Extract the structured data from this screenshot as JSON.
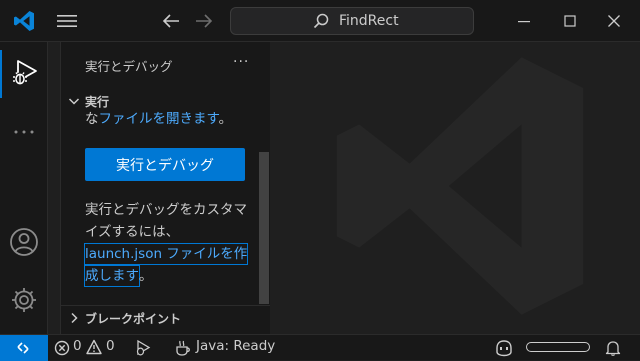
{
  "colors": {
    "accent": "#0078d4",
    "link": "#4daafc",
    "background": "#1f1f1f",
    "chrome": "#181818",
    "text": "#cccccc"
  },
  "titlebar": {
    "search_text": "FindRect",
    "icons": [
      "vscode-logo-icon",
      "hamburger-menu-icon",
      "arrow-left-icon",
      "arrow-right-icon",
      "search-icon",
      "minimize-icon",
      "maximize-icon",
      "close-icon"
    ]
  },
  "activity_bar": {
    "icons": [
      "run-debug-icon",
      "more-icon",
      "account-icon",
      "settings-gear-icon"
    ]
  },
  "sidebar": {
    "title": "実行とデバッグ",
    "more_label": "···",
    "run_section": {
      "label": "実行",
      "partial_prefix": "な",
      "partial_link": "ファイルを開きます",
      "partial_suffix": "。",
      "run_button": "実行とデバッグ",
      "customize_line1": "実行とデバッグをカスタマ",
      "customize_line2": "イズするには、",
      "customize_link_line1": "launch.json ファイルを作",
      "customize_link_line2": "成します",
      "customize_suffix": "。"
    },
    "breakpoints_section": {
      "label": "ブレークポイント"
    }
  },
  "statusbar": {
    "errors": "0",
    "warnings": "0",
    "java_status": "Java: Ready",
    "icons": [
      "remote-icon",
      "error-icon",
      "warning-icon",
      "debug-bug-icon",
      "java-icon",
      "copilot-icon",
      "notification-bell-icon"
    ]
  }
}
